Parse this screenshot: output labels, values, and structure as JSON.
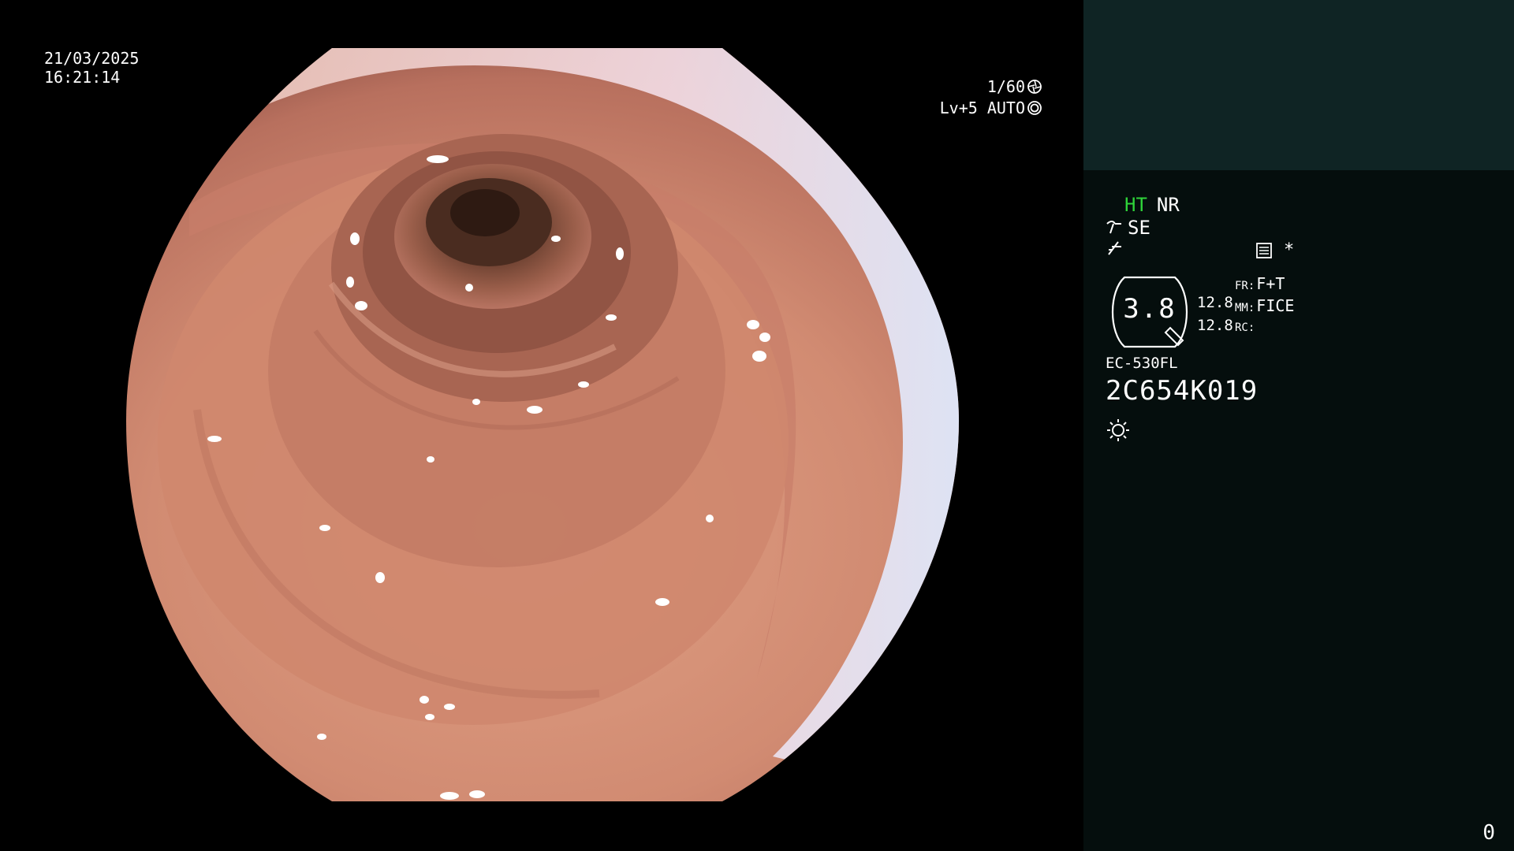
{
  "overlay": {
    "date": "21/03/2025",
    "time": "16:21:14",
    "shutter": "1/60",
    "shutter_icon": "aperture-icon",
    "iris": "Lv+5 AUTO",
    "iris_icon": "iris-ring-icon"
  },
  "panel": {
    "mode_ht": "HT",
    "mode_nr": "NR",
    "enhance_icon": "enhance-icon",
    "enhance": "SE",
    "freeze_icon": "freeze-icon",
    "menu_icon": "menu-list-icon",
    "star": "*",
    "zoom_value": "3.8",
    "gain_1": "12.8",
    "gain_2": "12.8",
    "fr_label": "FR:",
    "fr_value": "F+T",
    "mm_label": "MM:",
    "mm_value": "FICE",
    "rc_label": "RC:",
    "scope_model": "EC-530FL",
    "scope_serial": "2C654K019",
    "light_icon": "light-bulb-icon",
    "counter": "0"
  },
  "colors": {
    "panel_bg": "#050e0d",
    "panel_top_bg": "#0f2424",
    "mode_active": "#2fd43a"
  }
}
